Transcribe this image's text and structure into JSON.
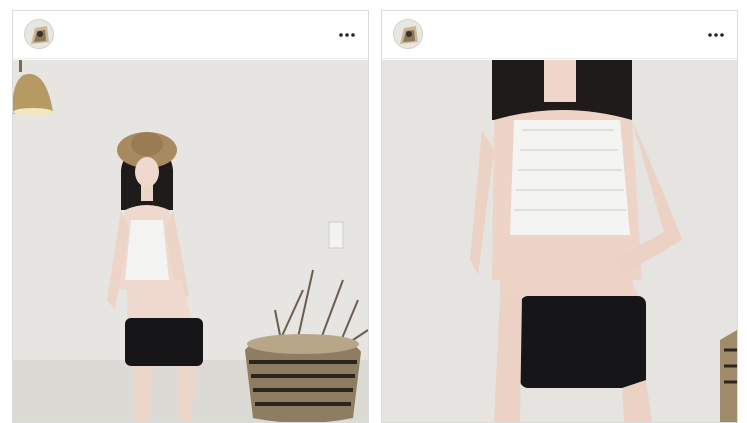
{
  "posts": [
    {
      "avatar": "user-avatar",
      "menu_icon": "more-options-icon",
      "photo": "swimwear-photo-full-body"
    },
    {
      "avatar": "user-avatar",
      "menu_icon": "more-options-icon",
      "photo": "swimwear-photo-closeup"
    }
  ],
  "colors": {
    "border": "#dbdbdb",
    "wall": "#e9e8e4",
    "top": "#f2f2f0",
    "shorts": "#161618"
  }
}
